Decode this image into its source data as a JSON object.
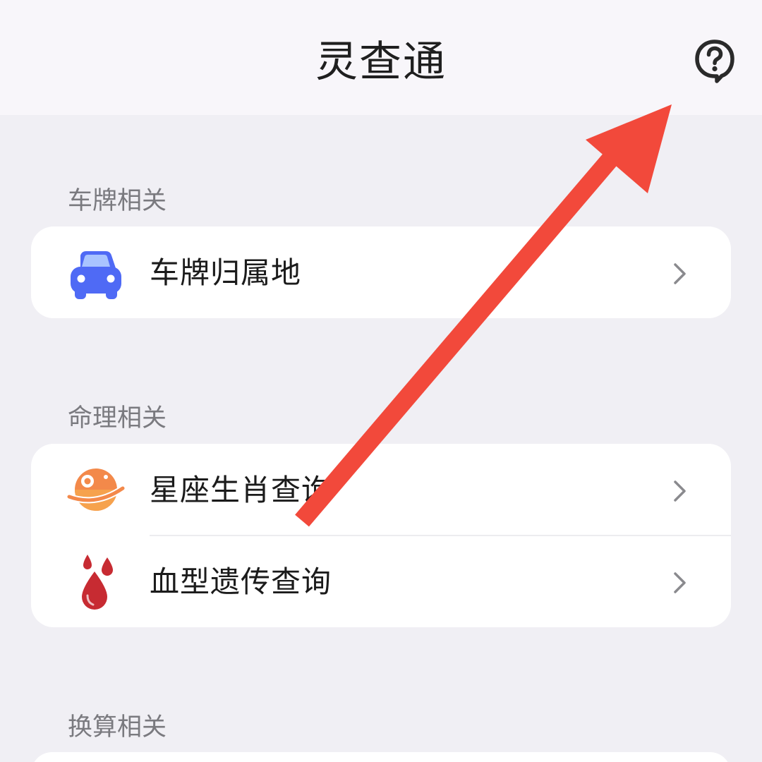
{
  "header": {
    "title": "灵查通",
    "help_icon": "help-bubble-icon"
  },
  "sections": [
    {
      "title": "车牌相关",
      "items": [
        {
          "label": "车牌归属地",
          "icon": "car-icon"
        }
      ]
    },
    {
      "title": "命理相关",
      "items": [
        {
          "label": "星座生肖查询",
          "icon": "planet-icon"
        },
        {
          "label": "血型遗传查询",
          "icon": "blood-drop-icon"
        }
      ]
    },
    {
      "title": "换算相关",
      "items": []
    }
  ],
  "colors": {
    "background": "#f0eff4",
    "header_background": "#f8f6fa",
    "card_background": "#ffffff",
    "car_icon": "#4f6af5",
    "planet_icon": "#f3894a",
    "blood_icon": "#c72b32",
    "annotation_arrow": "#f2493b"
  }
}
